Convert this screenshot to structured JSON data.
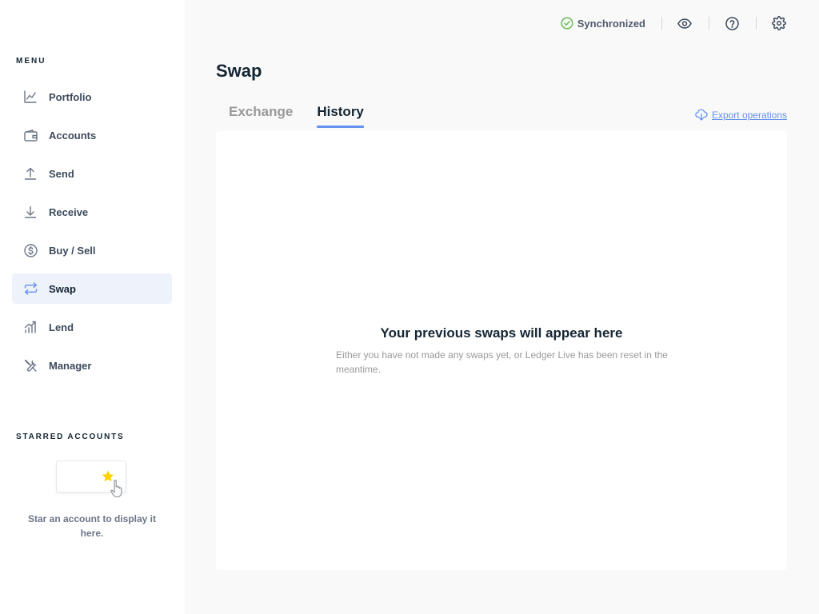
{
  "sidebar": {
    "menu_title": "MENU",
    "items": [
      {
        "label": "Portfolio",
        "icon": "chart-line-icon"
      },
      {
        "label": "Accounts",
        "icon": "wallet-icon"
      },
      {
        "label": "Send",
        "icon": "upload-icon"
      },
      {
        "label": "Receive",
        "icon": "download-icon"
      },
      {
        "label": "Buy / Sell",
        "icon": "dollar-icon"
      },
      {
        "label": "Swap",
        "icon": "swap-icon",
        "active": true
      },
      {
        "label": "Lend",
        "icon": "chart-bars-icon"
      },
      {
        "label": "Manager",
        "icon": "tools-icon"
      }
    ],
    "starred_title": "STARRED ACCOUNTS",
    "starred_empty": "Star an account to display it here."
  },
  "topbar": {
    "sync_status": "Synchronized",
    "icons": [
      "eye-icon",
      "help-icon",
      "settings-icon"
    ]
  },
  "main": {
    "title": "Swap",
    "tabs": [
      {
        "label": "Exchange",
        "active": false
      },
      {
        "label": "History",
        "active": true
      }
    ],
    "export_label": "Export operations",
    "empty_title": "Your previous swaps will appear here",
    "empty_desc": "Either you have not made any swaps yet, or Ledger Live has been reset in the meantime."
  },
  "colors": {
    "accent": "#6490f1",
    "success": "#66be54",
    "star": "#ffd200"
  }
}
